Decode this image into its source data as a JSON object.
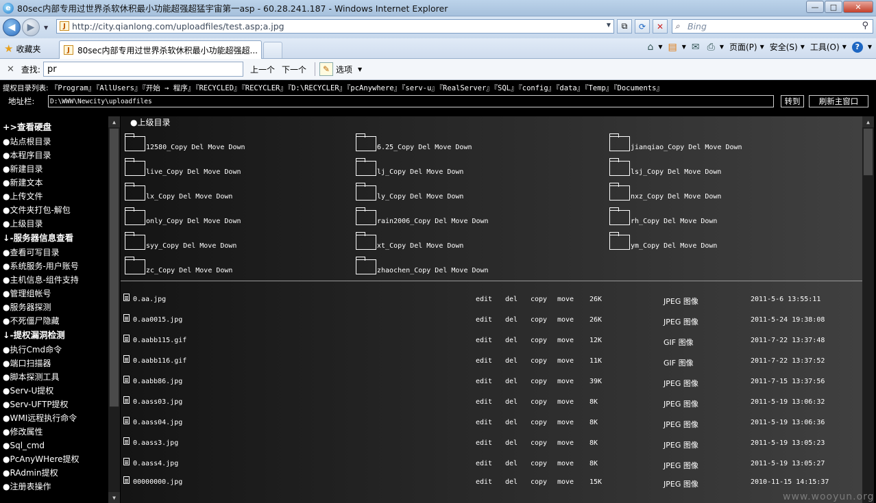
{
  "window": {
    "title": "80sec内部专用过世界杀软休积最小功能超强超猛宇宙第一asp - 60.28.241.187 - Windows Internet Explorer",
    "logo_glyph": "e",
    "min_glyph": "—",
    "max_glyph": "□",
    "close_glyph": "✕"
  },
  "address_bar": {
    "url": "http://city.qianlong.com/uploadfiles/test.asp;a.jpg",
    "favicon_glyph": "J",
    "search_placeholder": "Bing",
    "back_glyph": "◀",
    "forward_glyph": "▶",
    "caret": "▼",
    "compat_glyph": "⧉",
    "refresh_glyph": "⟳",
    "stop_glyph": "✕",
    "search_glyph": "⌕",
    "search_go_glyph": "⚲"
  },
  "tabs": {
    "favorites_label": "收藏夹",
    "favorites_icon": "★",
    "active_tab_title": "80sec内部专用过世界杀软休积最小功能超强超...",
    "active_tab_icon": "J"
  },
  "command_bar": {
    "home_icon": "⌂",
    "feeds_icon": "▤",
    "mail_icon": "✉",
    "print_icon": "⎙",
    "help_icon": "?",
    "caret": "▼",
    "page_label": "页面(P)",
    "safety_label": "安全(S)",
    "tools_label": "工具(O)"
  },
  "find_bar": {
    "close_glyph": "✕",
    "label": "查找:",
    "query": "pr",
    "prev_label": "上一个",
    "next_label": "下一个",
    "options_label": "选项",
    "options_icon": "✎",
    "caret": "▼"
  },
  "privilege_dirs": {
    "label": "提权目录列表:",
    "items": [
      "『Program』",
      "『AllUsers』",
      "『开始 → 程序』",
      "『RECYCLED』",
      "『RECYCLER』",
      "『D:\\RECYCLER』",
      "『pcAnywhere』",
      "『serv-u』",
      "『RealServer』",
      "『SQL』",
      "『config』",
      "『data』",
      "『Temp』",
      "『Documents』"
    ]
  },
  "path_row": {
    "label": "地址栏:",
    "path": "D:\\WWW\\Newcity\\uploadfiles",
    "goto_label": "转到",
    "refresh_label": "刷新主窗口"
  },
  "sidebar": {
    "items": [
      {
        "label": "+>查看硬盘",
        "head": true
      },
      {
        "label": "●站点根目录"
      },
      {
        "label": "●本程序目录"
      },
      {
        "label": "●新建目录"
      },
      {
        "label": "●新建文本"
      },
      {
        "label": "●上传文件"
      },
      {
        "label": "●文件夹打包-解包"
      },
      {
        "label": "●上级目录"
      },
      {
        "label": "↓-服务器信息查看",
        "head": true
      },
      {
        "label": "●查看可写目录"
      },
      {
        "label": "●系统服务-用户账号"
      },
      {
        "label": "●主机信息-组件支持"
      },
      {
        "label": "●管理组帐号"
      },
      {
        "label": "●服务器探测"
      },
      {
        "label": "●不死僵尸隐藏"
      },
      {
        "label": "↓-提权漏洞检测",
        "head": true
      },
      {
        "label": "●执行Cmd命令"
      },
      {
        "label": "●端口扫描器"
      },
      {
        "label": "●脚本探测工具"
      },
      {
        "label": "●Serv-U提权"
      },
      {
        "label": "●Serv-UFTP提权"
      },
      {
        "label": "●WMI远程执行命令"
      },
      {
        "label": "●修改属性"
      },
      {
        "label": "●Sql_cmd"
      },
      {
        "label": "●PcAnyWHere提权"
      },
      {
        "label": "●RAdmin提权"
      },
      {
        "label": "●注册表操作"
      }
    ]
  },
  "scroll": {
    "up": "▲",
    "down": "▼"
  },
  "content": {
    "parent_dir_label": "●上级目录",
    "directories": [
      [
        "12580",
        "6.25",
        "jianqiao"
      ],
      [
        "live",
        "lj",
        "lsj"
      ],
      [
        "lx",
        "ly",
        "nxz"
      ],
      [
        "only",
        "rain2006",
        "rh"
      ],
      [
        "syy",
        "xt",
        "ym"
      ],
      [
        "zc",
        "zhaochen"
      ]
    ],
    "dir_actions": " _Copy Del Move Down",
    "file_actions": {
      "edit": "edit",
      "del": "del",
      "copy": "copy",
      "move": "move"
    },
    "files": [
      {
        "name": "0.aa.jpg",
        "size": "26K",
        "type": "JPEG 图像",
        "date": "2011-5-6 13:55:11"
      },
      {
        "name": "0.aa0015.jpg",
        "size": "26K",
        "type": "JPEG 图像",
        "date": "2011-5-24 19:38:08"
      },
      {
        "name": "0.aabb115.gif",
        "size": "12K",
        "type": "GIF 图像",
        "date": "2011-7-22 13:37:48"
      },
      {
        "name": "0.aabb116.gif",
        "size": "11K",
        "type": "GIF 图像",
        "date": "2011-7-22 13:37:52"
      },
      {
        "name": "0.aabb86.jpg",
        "size": "39K",
        "type": "JPEG 图像",
        "date": "2011-7-15 13:37:56"
      },
      {
        "name": "0.aass03.jpg",
        "size": "8K",
        "type": "JPEG 图像",
        "date": "2011-5-19 13:06:32"
      },
      {
        "name": "0.aass04.jpg",
        "size": "8K",
        "type": "JPEG 图像",
        "date": "2011-5-19 13:06:36"
      },
      {
        "name": "0.aass3.jpg",
        "size": "8K",
        "type": "JPEG 图像",
        "date": "2011-5-19 13:05:23"
      },
      {
        "name": "0.aass4.jpg",
        "size": "8K",
        "type": "JPEG 图像",
        "date": "2011-5-19 13:05:27"
      },
      {
        "name": "00000000.jpg",
        "size": "15K",
        "type": "JPEG 图像",
        "date": "2010-11-15 14:15:37"
      }
    ]
  },
  "watermark": "www.wooyun.org"
}
